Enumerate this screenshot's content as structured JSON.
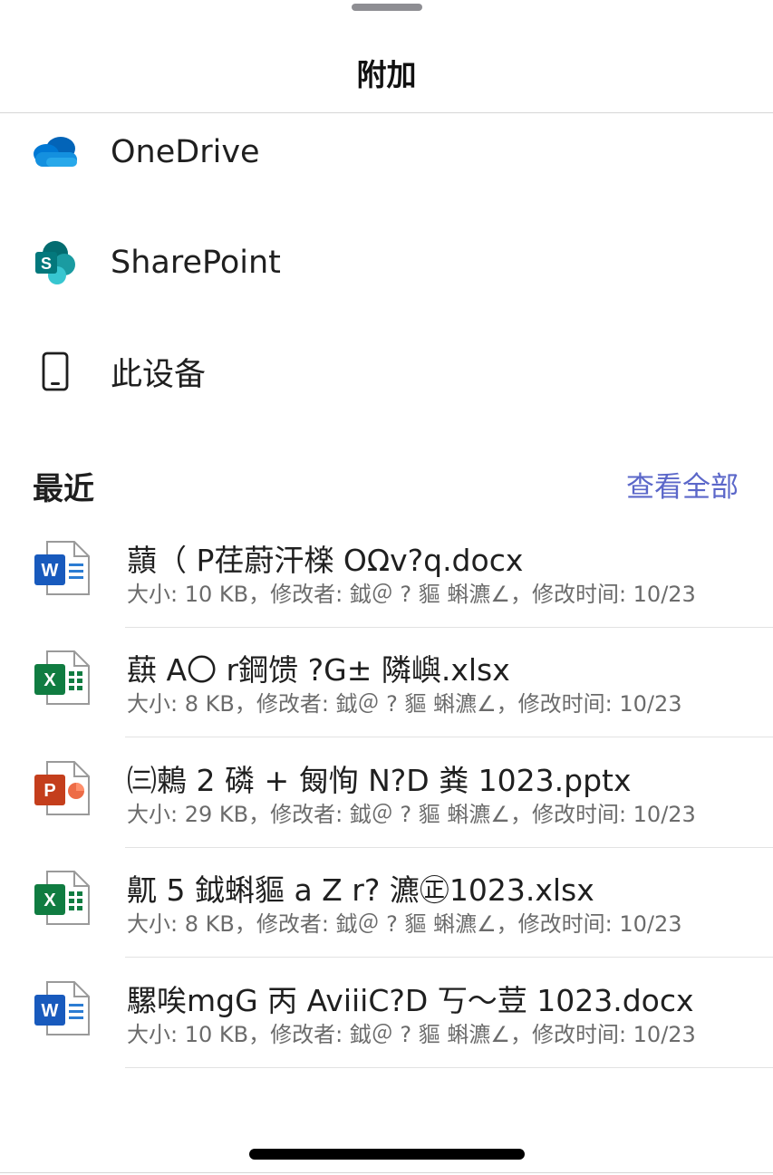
{
  "sheet": {
    "title": "附加"
  },
  "locations": [
    {
      "label": "OneDrive",
      "icon": "onedrive-cloud-icon"
    },
    {
      "label": "SharePoint",
      "icon": "sharepoint-icon"
    },
    {
      "label": "此设备",
      "icon": "phone-device-icon"
    }
  ],
  "recent": {
    "title": "最近",
    "see_all": "查看全部",
    "files": [
      {
        "name": "蘏（ P荏蔚汗檪 OΩv?q.docx",
        "meta": "大小: 10 KB，修改者: 鉞＠ ? 貙 蝌瀌∠，修改时间: 10/23",
        "type": "word"
      },
      {
        "name": "蕻 A〇 r鋼馈 ?G± 隣嶼.xlsx",
        "meta": "大小: 8 KB，修改者: 鉞＠ ? 貙 蝌瀌∠，修改时间: 10/23",
        "type": "excel"
      },
      {
        "name": "㈢鶫 2 磷 + 匓恂 N?D 粪 1023.pptx",
        "meta": "大小: 29 KB，修改者: 鉞＠ ? 貙 蝌瀌∠，修改时间: 10/23",
        "type": "powerpoint"
      },
      {
        "name": "鼿 5 鉞蝌貙 a Z r? 瀌㊣1023.xlsx",
        "meta": "大小: 8 KB，修改者: 鉞＠ ? 貙 蝌瀌∠，修改时间: 10/23",
        "type": "excel"
      },
      {
        "name": "騾唉mgG 丙 AviiiC?D 丂～荳 1023.docx",
        "meta": "大小: 10 KB，修改者: 鉞＠ ? 貙 蝌瀌∠，修改时间: 10/23",
        "type": "word"
      }
    ]
  },
  "colors": {
    "accent_link": "#5b67c9",
    "word": "#185abd",
    "excel": "#107c41",
    "powerpoint": "#c43e1c",
    "sharepoint": "#038387",
    "onedrive": "#0f6cbd"
  }
}
